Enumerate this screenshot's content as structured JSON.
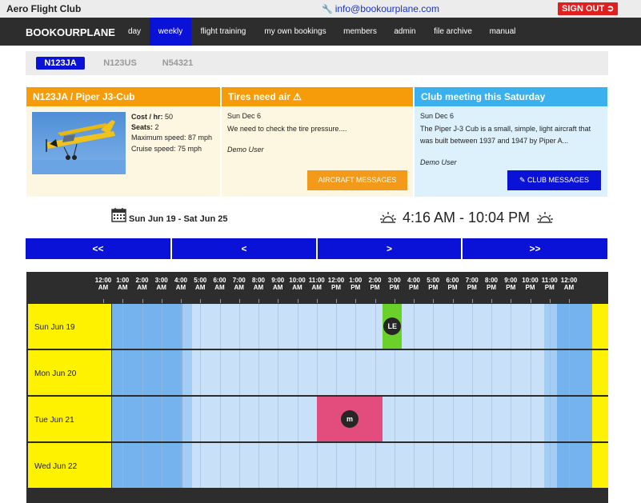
{
  "topbar": {
    "club_name": "Aero Flight Club",
    "email": "info@bookourplane.com",
    "sign_out": "SIGN OUT"
  },
  "nav": {
    "brand": "BOOKOURPLANE",
    "items": [
      "day",
      "weekly",
      "flight training",
      "my own bookings",
      "members",
      "admin",
      "file archive",
      "manual"
    ],
    "active": "weekly"
  },
  "aircraft_tabs": [
    "N123JA",
    "N123US",
    "N54321"
  ],
  "aircraft_panel": {
    "title": "N123JA / Piper J3-Cub",
    "cost_label": "Cost / hr:",
    "cost_value": "50",
    "seats_label": "Seats:",
    "seats_value": "2",
    "max_speed": "Maximum speed: 87 mph",
    "cruise_speed": "Cruise speed: 75 mph"
  },
  "aircraft_messages": {
    "title": "Tires need air",
    "date": "Sun Dec 6",
    "text": "We need to check the tire pressure....",
    "user": "Demo User",
    "button": "AIRCRAFT MESSAGES"
  },
  "club_messages": {
    "title": "Club meeting this Saturday",
    "date": "Sun Dec 6",
    "text": "The Piper J-3 Cub is a small, simple, light aircraft that was built between 1937 and 1947 by Piper A...",
    "user": "Demo User",
    "button": "CLUB MESSAGES"
  },
  "week_range": "Sun Jun 19 - Sat Jun 25",
  "daylight": "4:16 AM - 10:04 PM",
  "pager": [
    "<<",
    "<",
    ">",
    ">>"
  ],
  "hours": [
    [
      "12:00",
      "AM"
    ],
    [
      "1:00",
      "AM"
    ],
    [
      "2:00",
      "AM"
    ],
    [
      "3:00",
      "AM"
    ],
    [
      "4:00",
      "AM"
    ],
    [
      "5:00",
      "AM"
    ],
    [
      "6:00",
      "AM"
    ],
    [
      "7:00",
      "AM"
    ],
    [
      "8:00",
      "AM"
    ],
    [
      "9:00",
      "AM"
    ],
    [
      "10:00",
      "AM"
    ],
    [
      "11:00",
      "AM"
    ],
    [
      "12:00",
      "PM"
    ],
    [
      "1:00",
      "PM"
    ],
    [
      "2:00",
      "PM"
    ],
    [
      "3:00",
      "PM"
    ],
    [
      "4:00",
      "PM"
    ],
    [
      "5:00",
      "PM"
    ],
    [
      "6:00",
      "PM"
    ],
    [
      "7:00",
      "PM"
    ],
    [
      "8:00",
      "PM"
    ],
    [
      "9:00",
      "PM"
    ],
    [
      "10:00",
      "PM"
    ],
    [
      "11:00",
      "PM"
    ],
    [
      "12:00",
      "AM"
    ]
  ],
  "days": [
    "Sun Jun 19",
    "Mon Jun 20",
    "Tue Jun 21",
    "Wed Jun 22"
  ],
  "bookings": [
    {
      "day": "Sun Jun 19",
      "start_hour": 14.4,
      "end_hour": 15.4,
      "initials": "LE",
      "color": "#6ad12b"
    },
    {
      "day": "Tue Jun 21",
      "start_hour": 11.0,
      "end_hour": 14.4,
      "initials": "m",
      "color": "#e34d7d"
    }
  ],
  "colors": {
    "night": "#74b3ee",
    "twilight": "#a3cdf2",
    "day": "#c8e1f8",
    "day_label_bg": "#fff200",
    "accent": "#0b12d8"
  }
}
